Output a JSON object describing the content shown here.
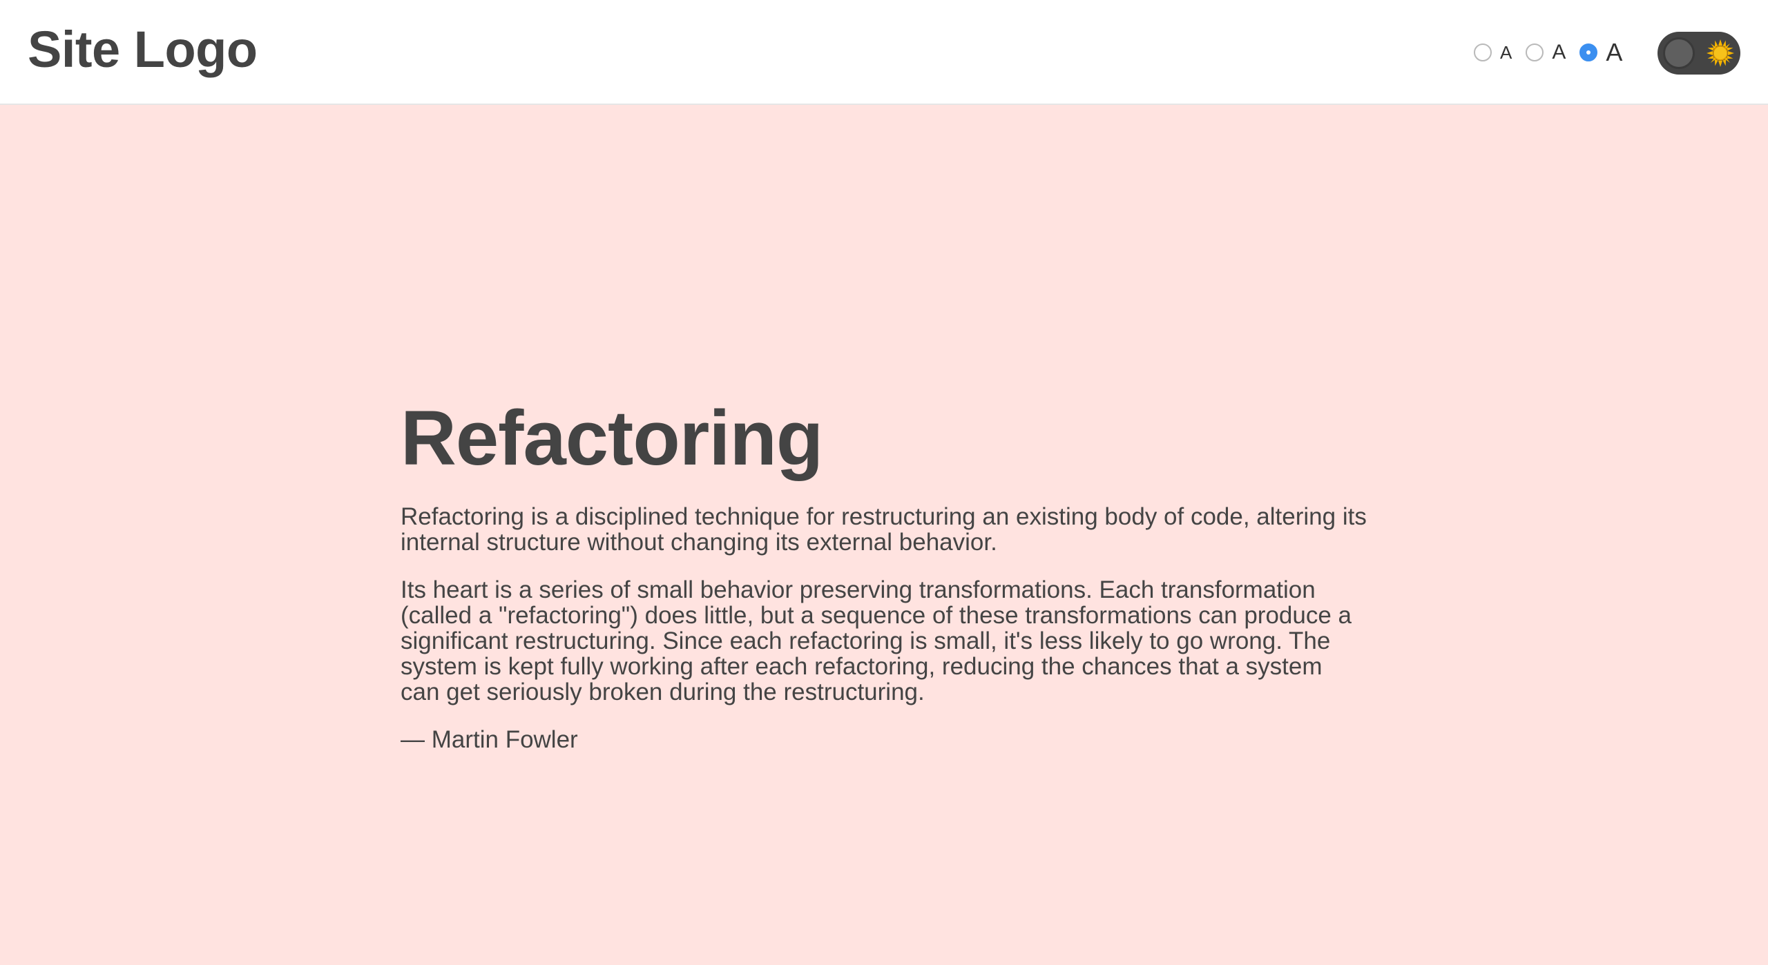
{
  "header": {
    "logo": "Site Logo",
    "font_size_options": [
      {
        "label": "A",
        "size": "small",
        "selected": false
      },
      {
        "label": "A",
        "size": "medium",
        "selected": false
      },
      {
        "label": "A",
        "size": "large",
        "selected": true
      }
    ],
    "theme_toggle": {
      "state": "light",
      "icon": "sun-icon"
    }
  },
  "article": {
    "title": "Refactoring",
    "paragraphs": [
      "Refactoring is a disciplined technique for restructuring an existing body of code, altering its internal structure without changing its external behavior.",
      "Its heart is a series of small behavior preserving transformations. Each transformation (called a \"refactoring\") does little, but a sequence of these transformations can produce a significant restructuring. Since each refactoring is small, it's less likely to go wrong. The system is kept fully working after each refactoring, reducing the chances that a system can get seriously broken during the restructuring."
    ],
    "attribution": "— Martin Fowler"
  },
  "colors": {
    "background": "#ffe3e0",
    "header_background": "#ffffff",
    "text": "#444444",
    "radio_selected": "#3b8ff0",
    "toggle_track": "#444444",
    "sun": "#f5b400"
  }
}
